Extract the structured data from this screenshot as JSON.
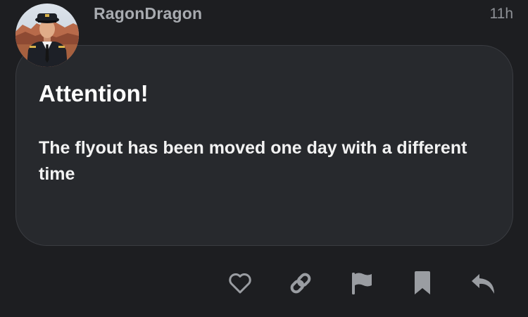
{
  "post": {
    "username": "RagonDragon",
    "time_ago": "11h",
    "avatar_icon": "pilot-avatar",
    "heading": "Attention!",
    "body": "The flyout has been moved one day with a different time"
  },
  "actions": [
    {
      "name": "like-button",
      "icon": "heart-icon"
    },
    {
      "name": "copy-link-button",
      "icon": "link-icon"
    },
    {
      "name": "flag-button",
      "icon": "flag-icon"
    },
    {
      "name": "bookmark-button",
      "icon": "bookmark-icon"
    },
    {
      "name": "reply-button",
      "icon": "reply-icon"
    }
  ],
  "colors": {
    "background": "#1d1e21",
    "card": "#27292d",
    "username": "#a8abb0",
    "icon": "#9a9da2"
  }
}
